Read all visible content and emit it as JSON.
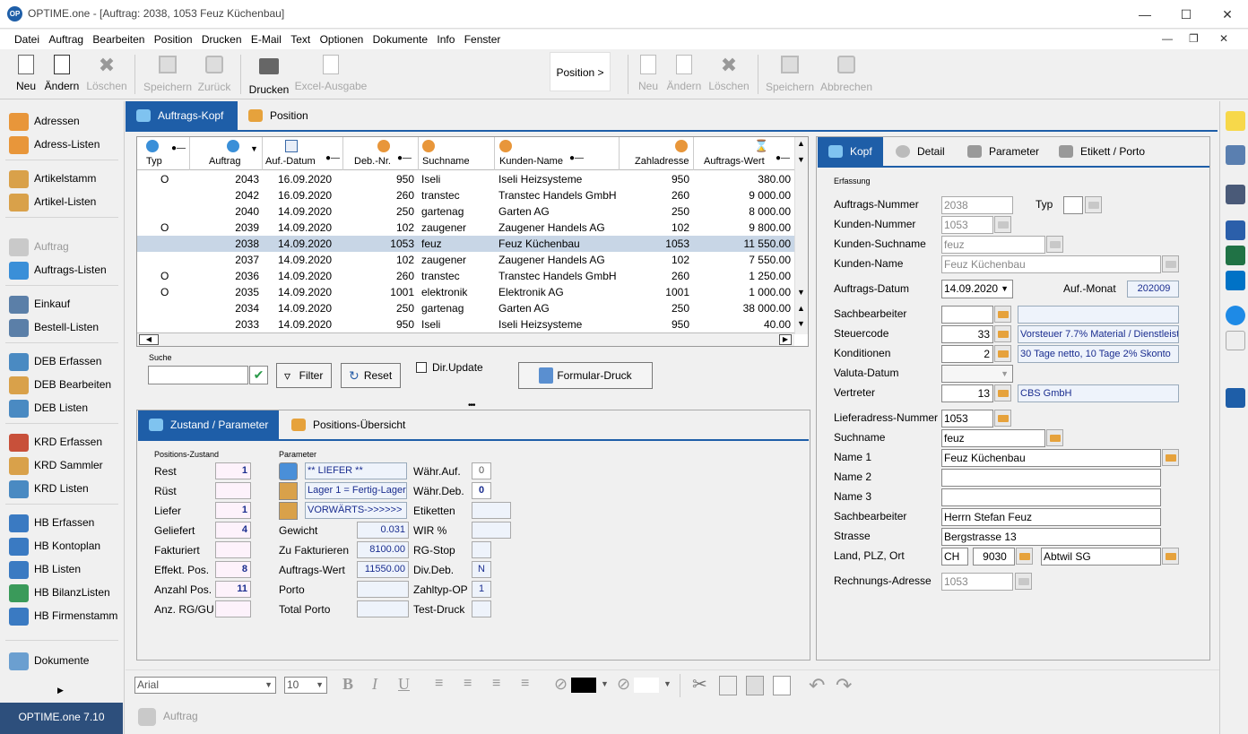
{
  "window": {
    "title": "OPTIME.one - [Auftrag: 2038,   1053  Feuz Küchenbau]",
    "logo": "OP"
  },
  "menu": [
    "Datei",
    "Auftrag",
    "Bearbeiten",
    "Position",
    "Drucken",
    "E-Mail",
    "Text",
    "Optionen",
    "Dokumente",
    "Info",
    "Fenster"
  ],
  "toolbar": {
    "neu": "Neu",
    "aendern": "Ändern",
    "loeschen": "Löschen",
    "speichern": "Speichern",
    "zurueck": "Zurück",
    "drucken": "Drucken",
    "excel": "Excel-Ausgabe",
    "position": "Position >",
    "neu2": "Neu",
    "aendern2": "Ändern",
    "loeschen2": "Löschen",
    "speichern2": "Speichern",
    "abbrechen2": "Abbrechen"
  },
  "sidebar": [
    {
      "label": "Adressen"
    },
    {
      "label": "Adress-Listen"
    },
    {
      "label": "Artikelstamm"
    },
    {
      "label": "Artikel-Listen"
    },
    {
      "label": "Auftrag"
    },
    {
      "label": "Auftrags-Listen"
    },
    {
      "label": "Einkauf"
    },
    {
      "label": "Bestell-Listen"
    },
    {
      "label": "DEB Erfassen"
    },
    {
      "label": "DEB Bearbeiten"
    },
    {
      "label": "DEB Listen"
    },
    {
      "label": "KRD Erfassen"
    },
    {
      "label": "KRD Sammler"
    },
    {
      "label": "KRD Listen"
    },
    {
      "label": "HB Erfassen"
    },
    {
      "label": "HB Kontoplan"
    },
    {
      "label": "HB Listen"
    },
    {
      "label": "HB BilanzListen"
    },
    {
      "label": "HB Firmenstamm"
    },
    {
      "label": "Dokumente"
    }
  ],
  "version": "OPTIME.one  7.10",
  "main_tabs": {
    "kopf": "Auftrags-Kopf",
    "position": "Position"
  },
  "grid": {
    "headers": [
      "Typ",
      "Auftrag",
      "Auf.-Datum",
      "Deb.-Nr.",
      "Suchname",
      "Kunden-Name",
      "Zahladresse",
      "Auftrags-Wert"
    ],
    "rows": [
      {
        "typ": "O",
        "auftrag": "2043",
        "datum": "16.09.2020",
        "deb": "950",
        "such": "Iseli",
        "name": "Iseli Heizsysteme",
        "zahl": "950",
        "wert": "380.00"
      },
      {
        "typ": "",
        "auftrag": "2042",
        "datum": "16.09.2020",
        "deb": "260",
        "such": "transtec",
        "name": "Transtec Handels GmbH",
        "zahl": "260",
        "wert": "9 000.00"
      },
      {
        "typ": "",
        "auftrag": "2040",
        "datum": "14.09.2020",
        "deb": "250",
        "such": "gartenag",
        "name": "Garten AG",
        "zahl": "250",
        "wert": "8 000.00"
      },
      {
        "typ": "O",
        "auftrag": "2039",
        "datum": "14.09.2020",
        "deb": "102",
        "such": "zaugener",
        "name": "Zaugener Handels AG",
        "zahl": "102",
        "wert": "9 800.00"
      },
      {
        "typ": "",
        "auftrag": "2038",
        "datum": "14.09.2020",
        "deb": "1053",
        "such": "feuz",
        "name": "Feuz Küchenbau",
        "zahl": "1053",
        "wert": "11 550.00"
      },
      {
        "typ": "",
        "auftrag": "2037",
        "datum": "14.09.2020",
        "deb": "102",
        "such": "zaugener",
        "name": "Zaugener Handels AG",
        "zahl": "102",
        "wert": "7 550.00"
      },
      {
        "typ": "O",
        "auftrag": "2036",
        "datum": "14.09.2020",
        "deb": "260",
        "such": "transtec",
        "name": "Transtec Handels GmbH",
        "zahl": "260",
        "wert": "1 250.00"
      },
      {
        "typ": "O",
        "auftrag": "2035",
        "datum": "14.09.2020",
        "deb": "1001",
        "such": "elektronik",
        "name": "Elektronik AG",
        "zahl": "1001",
        "wert": "1 000.00"
      },
      {
        "typ": "",
        "auftrag": "2034",
        "datum": "14.09.2020",
        "deb": "250",
        "such": "gartenag",
        "name": "Garten AG",
        "zahl": "250",
        "wert": "38 000.00"
      },
      {
        "typ": "",
        "auftrag": "2033",
        "datum": "14.09.2020",
        "deb": "950",
        "such": "Iseli",
        "name": "Iseli Heizsysteme",
        "zahl": "950",
        "wert": "40.00"
      }
    ],
    "selected_index": 4
  },
  "search": {
    "label": "Suche",
    "value": "",
    "filter": "Filter",
    "reset": "Reset",
    "dirupdate": "Dir.Update",
    "formular": "Formular-Druck"
  },
  "bottom_tabs": {
    "zustand": "Zustand / Parameter",
    "uebersicht": "Positions-Übersicht"
  },
  "zustand": {
    "heading": "Positions-Zustand",
    "items": [
      {
        "label": "Rest",
        "value": "1"
      },
      {
        "label": "Rüst",
        "value": ""
      },
      {
        "label": "Liefer",
        "value": "1"
      },
      {
        "label": "Geliefert",
        "value": "4"
      },
      {
        "label": "Fakturiert",
        "value": ""
      },
      {
        "label": "Effekt. Pos.",
        "value": "8"
      },
      {
        "label": "Anzahl Pos.",
        "value": "11"
      },
      {
        "label": "Anz. RG/GU",
        "value": ""
      }
    ]
  },
  "parameter": {
    "heading": "Parameter",
    "status1": "** LIEFER **",
    "status2": "Lager 1 = Fertig-Lager",
    "status3": "VORWÄRTS->>>>>>",
    "gewicht_label": "Gewicht",
    "gewicht": "0.031",
    "zufakt_label": "Zu Fakturieren",
    "zufakt": "8100.00",
    "wert_label": "Auftrags-Wert",
    "wert": "11550.00",
    "porto_label": "Porto",
    "porto": "",
    "totalporto_label": "Total Porto",
    "totalporto": ""
  },
  "parameter2": [
    {
      "label": "Währ.Auf.",
      "value": "0"
    },
    {
      "label": "Währ.Deb.",
      "value": "0"
    },
    {
      "label": "Etiketten",
      "value": ""
    },
    {
      "label": "WIR %",
      "value": ""
    },
    {
      "label": "RG-Stop",
      "value": ""
    },
    {
      "label": "Div.Deb.",
      "value": "N"
    },
    {
      "label": "Zahltyp-OP",
      "value": "1"
    },
    {
      "label": "Test-Druck",
      "value": ""
    }
  ],
  "right_tabs": {
    "kopf": "Kopf",
    "detail": "Detail",
    "parameter": "Parameter",
    "etikett": "Etikett / Porto"
  },
  "kopf": {
    "erfassung": "Erfassung",
    "auftragsnummer_label": "Auftrags-Nummer",
    "auftragsnummer": "2038",
    "typ_label": "Typ",
    "typ": "",
    "kundennummer_label": "Kunden-Nummer",
    "kundennummer": "1053",
    "kundensuch_label": "Kunden-Suchname",
    "kundensuch": "feuz",
    "kundenname_label": "Kunden-Name",
    "kundenname": "Feuz Küchenbau",
    "datum_label": "Auftrags-Datum",
    "datum": "14.09.2020",
    "monat_label": "Auf.-Monat",
    "monat": "202009",
    "sachbearbeiter_label": "Sachbearbeiter",
    "sachbearbeiter": "",
    "sachbearbeiter_text": "",
    "steuercode_label": "Steuercode",
    "steuercode": "33",
    "steuercode_text": "Vorsteuer 7.7% Material / Dienstleist.",
    "konditionen_label": "Konditionen",
    "konditionen": "2",
    "konditionen_text": "30 Tage netto, 10 Tage 2% Skonto",
    "valuta_label": "Valuta-Datum",
    "valuta": "",
    "vertreter_label": "Vertreter",
    "vertreter": "13",
    "vertreter_text": "CBS GmbH",
    "lieferadresse_label": "Lieferadress-Nummer",
    "lieferadresse": "1053",
    "suchname_label": "Suchname",
    "suchname": "feuz",
    "name1_label": "Name 1",
    "name1": "Feuz Küchenbau",
    "name2_label": "Name 2",
    "name2": "",
    "name3_label": "Name 3",
    "name3": "",
    "sach2_label": "Sachbearbeiter",
    "sach2": "Herrn Stefan Feuz",
    "strasse_label": "Strasse",
    "strasse": "Bergstrasse 13",
    "ort_label": "Land, PLZ, Ort",
    "land": "CH",
    "plz": "9030",
    "ort": "Abtwil SG",
    "rechnung_label": "Rechnungs-Adresse",
    "rechnung": "1053"
  },
  "format": {
    "font": "Arial",
    "size": "10"
  },
  "status": {
    "auftrag": "Auftrag"
  }
}
